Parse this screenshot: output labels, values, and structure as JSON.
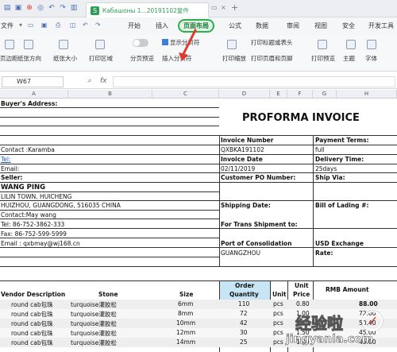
{
  "quickbar": {
    "icons": [
      "file-icon",
      "save-icon",
      "print-icon",
      "preview-icon",
      "undo-icon",
      "redo-icon",
      "cut-icon",
      "paste-icon",
      "format-icon"
    ]
  },
  "tab": {
    "title": "Кабашоны 1...20191102复件",
    "close": "×",
    "add": "+"
  },
  "menu": {
    "file": "文件",
    "items": [
      "开始",
      "插入",
      "页面布局",
      "公式",
      "数据",
      "审阅",
      "视图",
      "安全",
      "开发工具"
    ],
    "active": "页面布局"
  },
  "ribbon": {
    "margins": "页边距",
    "orientation": "纸张方向",
    "size": "纸张大小",
    "print_area": "打印区域",
    "page_preview": "分页预览",
    "show_breaks": "显示分页符",
    "insert_break": "插入分页符",
    "print_scale": "打印缩放",
    "print_titles": "打印标题或表头",
    "print_header_footer": "打印页眉和页脚",
    "print_preview": "打印预览",
    "theme": "主题",
    "font": "字体"
  },
  "formula_bar": {
    "cell_ref": "W67",
    "fx": "fx",
    "value": ""
  },
  "columns": [
    "A",
    "B",
    "C",
    "D",
    "E",
    "F",
    "G",
    "H"
  ],
  "invoice": {
    "title": "PROFORMA  INVOICE",
    "buyer_address": "Buyer's Address:",
    "contact": "Contact :Karamba",
    "tel": "Tel:",
    "email": "Email:",
    "seller": "Seller:",
    "seller_name": "WANG PING",
    "seller_addr1": "LILIN TOWN, HUICHENG",
    "seller_addr2": "HUIZHOU, GUANGDONG, 516035 CHINA",
    "seller_contact": "Contact:May wang",
    "seller_tel": "Tel:  86-752-3862-333",
    "seller_fax": "Fax: 86-752-599-5999",
    "seller_email": "Email : qxbmay@wj168.cn",
    "invoice_number_label": "Invoice Number",
    "invoice_number": "QXBKA191102",
    "invoice_date_label": "Invoice Date",
    "invoice_date": "02/11/2019",
    "customer_po": "Customer PO Number:",
    "shipping_date": "Shipping Date:",
    "trans_shipment": "For Trans Shipment to:",
    "port_label": "Port of Consolidation",
    "port": "GUANGZHOU",
    "payment_terms_label": "Payment Terms:",
    "payment_terms": "full",
    "delivery_time_label": "Delivery Time:",
    "delivery_time": "25days",
    "ship_via": "Ship Via:",
    "bill_of_lading": "Bill of Lading #:",
    "usd_exchange": "USD Exchange",
    "rate": "Rate:"
  },
  "table": {
    "headers": {
      "desc": "Vendor Description",
      "stone": "Stone",
      "size": "Size",
      "order1": "Order",
      "order2": "Quantity",
      "unit": "Unit",
      "price1": "Unit",
      "price2": "Price",
      "amount": "RMB  Amount"
    },
    "rows": [
      {
        "desc": "round cab包珠",
        "stone": "turquoise灌胶松",
        "size": "6mm",
        "qty": "110",
        "unit": "pcs",
        "price": "0.80",
        "amount": "88.00"
      },
      {
        "desc": "round cab包珠",
        "stone": "turquoise灌胶松",
        "size": "8mm",
        "qty": "72",
        "unit": "pcs",
        "price": "1.00",
        "amount": "72.00"
      },
      {
        "desc": "round cab包珠",
        "stone": "turquoise灌胶松",
        "size": "10mm",
        "qty": "42",
        "unit": "pcs",
        "price": "1.20",
        "amount": "50.40"
      },
      {
        "desc": "round cab包珠",
        "stone": "turquoise灌胶松",
        "size": "12mm",
        "qty": "30",
        "unit": "pcs",
        "price": "1.50",
        "amount": "45.00"
      },
      {
        "desc": "round cab包珠",
        "stone": "turquoise灌胶松",
        "size": "14mm",
        "qty": "25",
        "unit": "pcs",
        "price": "1.80",
        "amount": "45.00"
      }
    ]
  },
  "watermark": {
    "cn": "经验啦",
    "url": "jingyanla.com"
  },
  "colors": {
    "accent_green": "#2fae4f",
    "arrow_red": "#e03a2e",
    "order_header_bg": "#c7e5f5"
  }
}
